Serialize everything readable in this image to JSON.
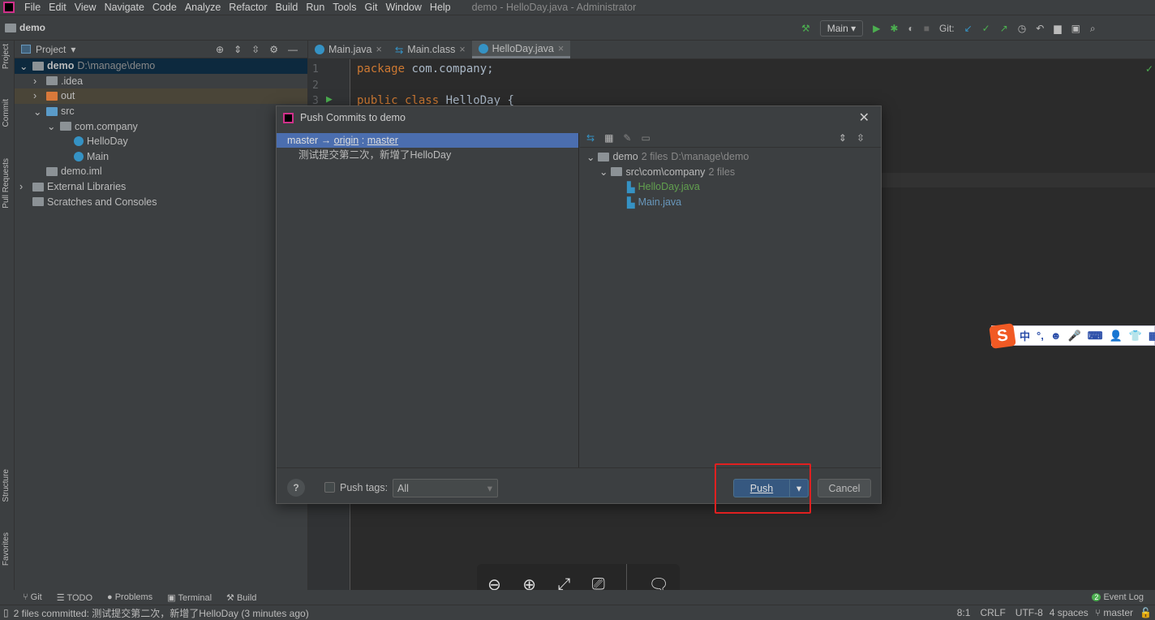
{
  "menubar": {
    "items": [
      "File",
      "Edit",
      "View",
      "Navigate",
      "Code",
      "Analyze",
      "Refactor",
      "Build",
      "Run",
      "Tools",
      "Git",
      "Window",
      "Help"
    ],
    "title": "demo - HelloDay.java - Administrator"
  },
  "navbar": {
    "crumb": "demo",
    "run_config": "Main",
    "git_label": "Git:"
  },
  "stripe": {
    "project": "Project",
    "commit": "Commit",
    "pull_requests": "Pull Requests",
    "structure": "Structure",
    "favorites": "Favorites"
  },
  "project": {
    "title": "Project",
    "tree": [
      {
        "label": "demo",
        "extra": "D:\\manage\\demo",
        "depth": 0,
        "arrow": "v"
      },
      {
        "label": ".idea",
        "depth": 1,
        "arrow": ">"
      },
      {
        "label": "out",
        "depth": 1,
        "arrow": ">"
      },
      {
        "label": "src",
        "depth": 1,
        "arrow": "v"
      },
      {
        "label": "com.company",
        "depth": 2,
        "arrow": "v"
      },
      {
        "label": "HelloDay",
        "depth": 3
      },
      {
        "label": "Main",
        "depth": 3
      },
      {
        "label": "demo.iml",
        "depth": 1
      },
      {
        "label": "External Libraries",
        "depth": 0,
        "arrow": ">"
      },
      {
        "label": "Scratches and Consoles",
        "depth": 0
      }
    ]
  },
  "tabs": [
    "Main.java",
    "Main.class",
    "HelloDay.java"
  ],
  "editor": {
    "lines": [
      "1",
      "2",
      "3"
    ],
    "line1_kw": "package",
    "line1_rest": " com.company;",
    "line3_kw": "public class",
    "line3_rest": " HelloDay {"
  },
  "dialog": {
    "title": "Push Commits to demo",
    "branch_from": "master",
    "arrow": "→",
    "remote": "origin",
    "sep": ":",
    "branch_to": "master",
    "commit": "测试提交第二次，新增了HelloDay",
    "tree": {
      "root": "demo",
      "root_count": "2 files",
      "root_path": "D:\\manage\\demo",
      "dir": "src\\com\\company",
      "dir_count": "2 files",
      "files": [
        "HelloDay.java",
        "Main.java"
      ]
    },
    "push_tags_label": "Push tags:",
    "push_tags_value": "All",
    "push": "Push",
    "cancel": "Cancel",
    "help": "?"
  },
  "bottom_tools": [
    "Git",
    "TODO",
    "Problems",
    "Terminal",
    "Build"
  ],
  "event_log": "Event Log",
  "event_count": "2",
  "status": {
    "message": "2 files committed: 测试提交第二次，新增了HelloDay (3 minutes ago)",
    "position": "8:1",
    "line_sep": "CRLF",
    "encoding": "UTF-8",
    "indent": "4 spaces",
    "branch": "master"
  },
  "ime": {
    "logo": "S",
    "items": [
      "中",
      "°,",
      "☻",
      "🎤",
      "⌨",
      "👤",
      "👕",
      "▦"
    ]
  },
  "image_viewer": {
    "icons": [
      "zoom-out",
      "zoom-in",
      "fit",
      "slideshow",
      "comment"
    ]
  }
}
